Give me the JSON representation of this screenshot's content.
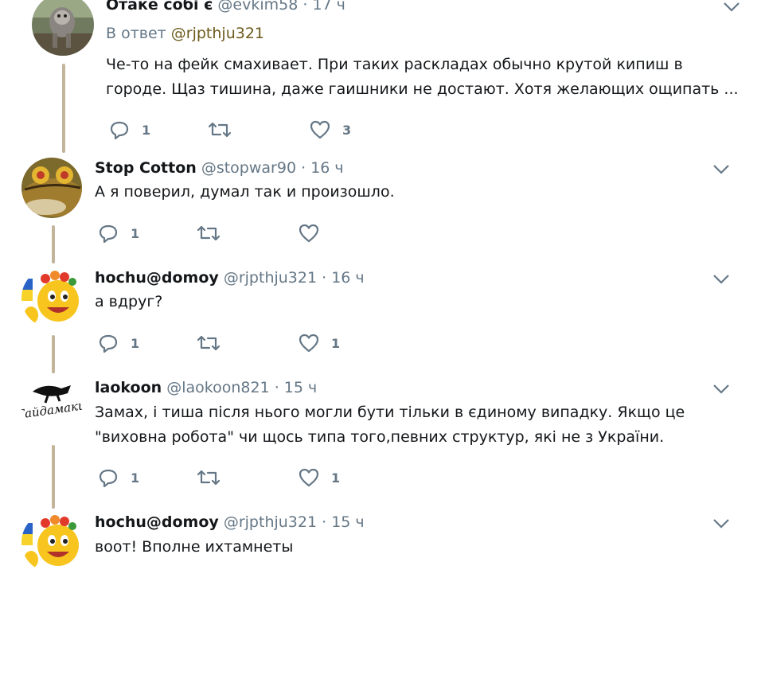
{
  "tweets": [
    {
      "name": "Отаке собі є",
      "handle": "@evkim58",
      "sep": "·",
      "time": "17 ч",
      "reply_label": "В ответ",
      "reply_handle": "@rjpthju321",
      "lines": [
        "Че-то на фейк смахивает. При таких раскладах обычно крутой кипиш в",
        "городе. Щаз тишина, даже гаишники не достают. Хотя желающих ощипать ..."
      ],
      "reply_count": "1",
      "retweet_count": "",
      "like_count": "3",
      "avatar_icon": "dog-photo-avatar"
    },
    {
      "name": "Stop Cotton",
      "handle": "@stopwar90",
      "sep": "·",
      "time": "16 ч",
      "lines": [
        "А я поверил, думал так и произошло."
      ],
      "reply_count": "1",
      "retweet_count": "",
      "like_count": "",
      "avatar_icon": "hypnotoad-avatar"
    },
    {
      "name": "hochu@domoy",
      "handle": "@rjpthju321",
      "sep": "·",
      "time": "16 ч",
      "lines": [
        "а вдруг?"
      ],
      "reply_count": "1",
      "retweet_count": "",
      "like_count": "1",
      "avatar_icon": "smiley-flag-avatar"
    },
    {
      "name": "laokoon",
      "handle": "@laokoon821",
      "sep": "·",
      "time": "15 ч",
      "lines": [
        "Замах, і тиша після нього могли бути тільки в єдиному випадку. Якщо це",
        "\"виховна робота\" чи щось типа того,певних структур, які не з України."
      ],
      "reply_count": "1",
      "retweet_count": "",
      "like_count": "1",
      "avatar_icon": "gaydamaki-logo-avatar"
    },
    {
      "name": "hochu@domoy",
      "handle": "@rjpthju321",
      "sep": "·",
      "time": "15 ч",
      "lines": [
        "воот! Вполне ихтамнеты"
      ],
      "avatar_icon": "smiley-flag-avatar"
    }
  ],
  "avatar_logo_text": "Гайдамаки",
  "colors": {
    "thread_line": "#c2b59b",
    "link": "#6d5a1d",
    "muted": "#657786",
    "text": "#14171a"
  }
}
